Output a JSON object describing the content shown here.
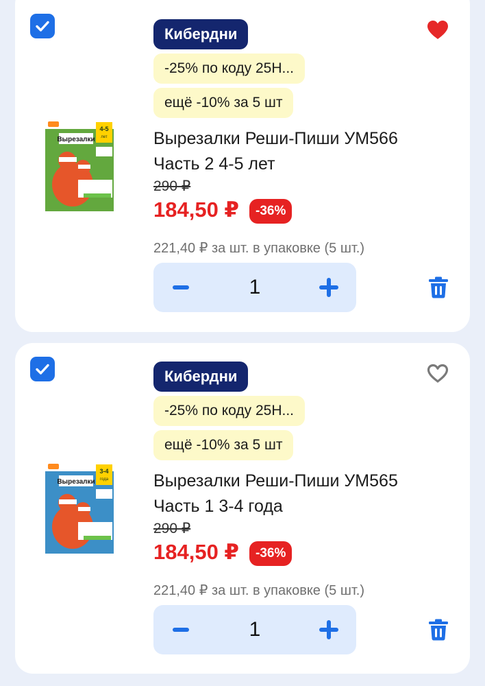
{
  "items": [
    {
      "checked": true,
      "favorited": true,
      "brand": "Кибердни",
      "promo_code": "-25% по коду 25Н...",
      "promo_bulk": "ещё -10% за 5 шт",
      "title": "Вырезалки Реши-Пиши УМ566 Часть 2 4-5 лет",
      "old_price": "290 ₽",
      "price": "184,50 ₽",
      "discount": "-36%",
      "pack_price": "221,40 ₽ за шт. в упаковке (5 шт.)",
      "quantity": "1",
      "cover": {
        "title": "Вырезалки",
        "age": "4-5",
        "age_unit": "лет",
        "color": "#63a83e"
      }
    },
    {
      "checked": true,
      "favorited": false,
      "brand": "Кибердни",
      "promo_code": "-25% по коду 25Н...",
      "promo_bulk": "ещё -10% за 5 шт",
      "title": "Вырезалки Реши-Пиши УМ565 Часть 1 3-4 года",
      "old_price": "290 ₽",
      "price": "184,50 ₽",
      "discount": "-36%",
      "pack_price": "221,40 ₽ за шт. в упаковке (5 шт.)",
      "quantity": "1",
      "cover": {
        "title": "Вырезалки",
        "age": "3-4",
        "age_unit": "года",
        "color": "#3c8fc7"
      }
    }
  ],
  "colors": {
    "accent_blue": "#1e6fe6",
    "brand_navy": "#14266e",
    "price_red": "#e62222",
    "promo_yellow": "#fdf9c9",
    "stepper_bg": "#dfebfd",
    "heart_active": "#e62828",
    "heart_inactive": "#7a7a7a"
  },
  "icons": {
    "checkbox": "check-icon",
    "favorite": "heart-icon",
    "decrement": "minus-icon",
    "increment": "plus-icon",
    "delete": "trash-icon"
  }
}
